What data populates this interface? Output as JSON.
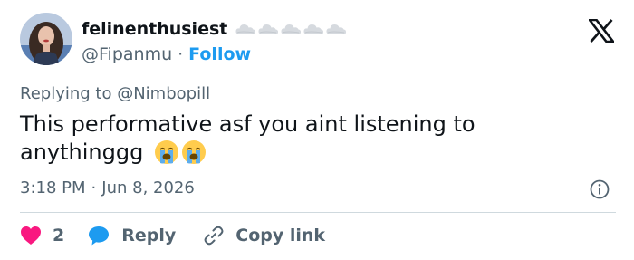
{
  "user": {
    "display_name": "felinenthusiest",
    "handle": "@Fipanmu",
    "separator": "·",
    "follow_label": "Follow",
    "badges": [
      "cloud-icon",
      "cloud-icon",
      "cloud-icon",
      "cloud-icon",
      "cloud-icon"
    ]
  },
  "tweet": {
    "replying_prefix": "Replying to",
    "replying_to": "@Nimbopill",
    "text": "This performative asf you aint listening to anythinggg",
    "emojis": [
      "loudly-crying-face",
      "loudly-crying-face"
    ],
    "time": "3:18 PM",
    "separator": "·",
    "date": "Jun 8, 2026"
  },
  "actions": {
    "like_count": "2",
    "reply_label": "Reply",
    "copy_link_label": "Copy link"
  },
  "colors": {
    "accent": "#1d9bf0",
    "heart": "#f91880",
    "text": "#0f1419",
    "muted": "#536471",
    "divider": "#cfd9de"
  }
}
